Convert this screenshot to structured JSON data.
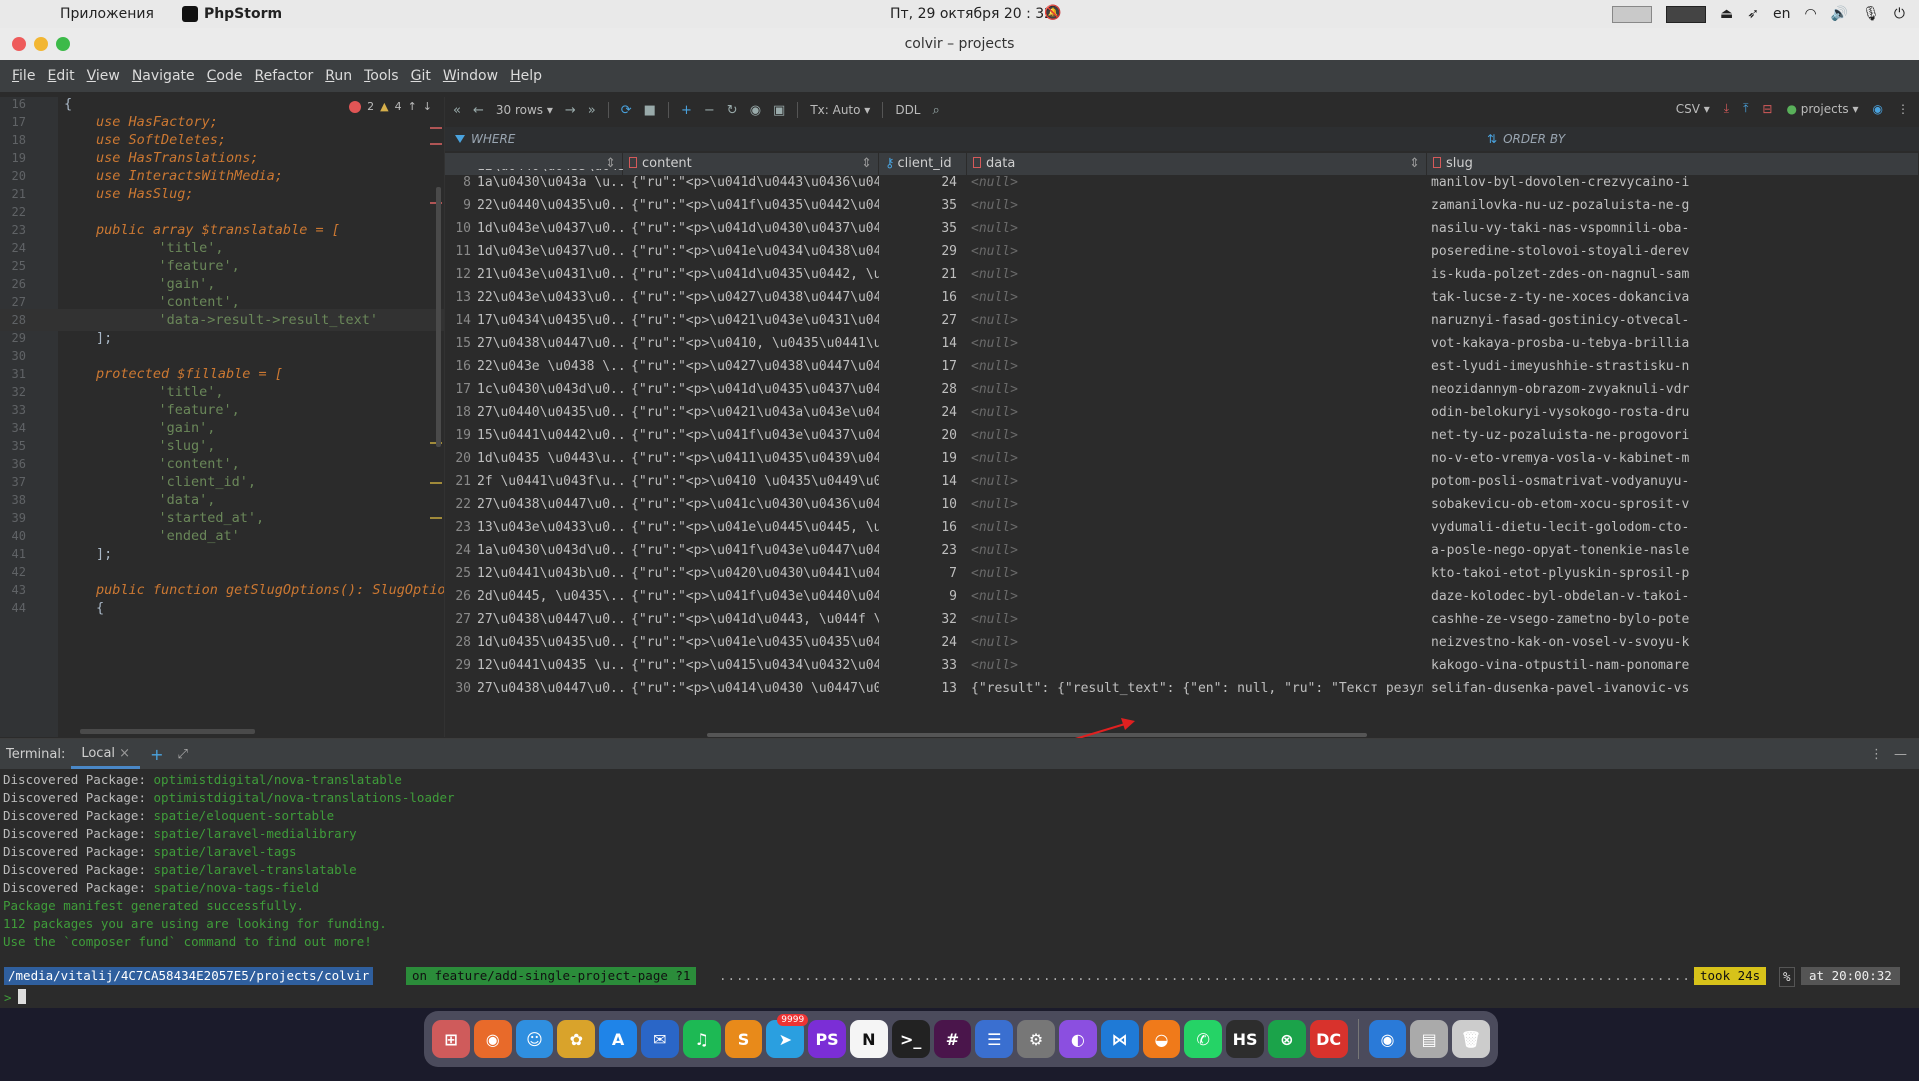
{
  "os": {
    "apple": "",
    "apps_menu": "Приложения",
    "app_name": "PhpStorm",
    "clock": "Пт, 29 октября 20 : 32",
    "lang": "en"
  },
  "window": {
    "title": "colvir – projects"
  },
  "menu": [
    "File",
    "Edit",
    "View",
    "Navigate",
    "Code",
    "Refactor",
    "Run",
    "Tools",
    "Git",
    "Window",
    "Help"
  ],
  "editor": {
    "errors": "2",
    "warnings": "4",
    "lines": [
      {
        "n": "16",
        "t": "{"
      },
      {
        "n": "17",
        "t": "use HasFactory;"
      },
      {
        "n": "18",
        "t": "use SoftDeletes;"
      },
      {
        "n": "19",
        "t": "use HasTranslations;"
      },
      {
        "n": "20",
        "t": "use InteractsWithMedia;"
      },
      {
        "n": "21",
        "t": "use HasSlug;"
      },
      {
        "n": "22",
        "t": ""
      },
      {
        "n": "23",
        "t": "public array $translatable = ["
      },
      {
        "n": "24",
        "t": "    'title',"
      },
      {
        "n": "25",
        "t": "    'feature',"
      },
      {
        "n": "26",
        "t": "    'gain',"
      },
      {
        "n": "27",
        "t": "    'content',"
      },
      {
        "n": "28",
        "t": "    'data->result->result_text'"
      },
      {
        "n": "29",
        "t": "];"
      },
      {
        "n": "30",
        "t": ""
      },
      {
        "n": "31",
        "t": "protected $fillable = ["
      },
      {
        "n": "32",
        "t": "    'title',"
      },
      {
        "n": "33",
        "t": "    'feature',"
      },
      {
        "n": "34",
        "t": "    'gain',"
      },
      {
        "n": "35",
        "t": "    'slug',"
      },
      {
        "n": "36",
        "t": "    'content',"
      },
      {
        "n": "37",
        "t": "    'client_id',"
      },
      {
        "n": "38",
        "t": "    'data',"
      },
      {
        "n": "39",
        "t": "    'started_at',"
      },
      {
        "n": "40",
        "t": "    'ended_at'"
      },
      {
        "n": "41",
        "t": "];"
      },
      {
        "n": "42",
        "t": ""
      },
      {
        "n": "43",
        "t": "public function getSlugOptions(): SlugOptior"
      },
      {
        "n": "44",
        "t": "{"
      }
    ]
  },
  "grid": {
    "rows_label": "30 rows",
    "tx_label": "Tx: Auto",
    "ddl_label": "DDL",
    "csv_label": "CSV",
    "schema_label": "projects",
    "where_label": "WHERE",
    "orderby_label": "ORDER BY",
    "columns": [
      "content",
      "client_id",
      "data",
      "slug"
    ],
    "top_partial": "12\\u0440\\u0435\\u0435\\u0",
    "null_text": "<null>",
    "rows": [
      {
        "n": "8",
        "title": "1a\\u0430\\u043a \\u...",
        "content": "{\"ru\":\"<p>\\u041d\\u0443\\u0436\\u043d\\u...",
        "client": "24",
        "data": "<null>",
        "slug": "manilov-byl-dovolen-crezvycaino-i"
      },
      {
        "n": "9",
        "title": "22\\u0440\\u0435\\u0...",
        "content": "{\"ru\":\"<p>\\u041f\\u0435\\u0442\\u0440\\u...",
        "client": "35",
        "data": "<null>",
        "slug": "zamanilovka-nu-uz-pozaluista-ne-g"
      },
      {
        "n": "10",
        "title": "1d\\u043e\\u0437\\u0...",
        "content": "{\"ru\":\"<p>\\u041d\\u0430\\u0437\\u0434\\u...",
        "client": "35",
        "data": "<null>",
        "slug": "nasilu-vy-taki-nas-vspomnili-oba-"
      },
      {
        "n": "11",
        "title": "1d\\u043e\\u0437\\u0...",
        "content": "{\"ru\":\"<p>\\u041e\\u0434\\u0438\\u043d \\u...",
        "client": "29",
        "data": "<null>",
        "slug": "poseredine-stolovoi-stoyali-derev"
      },
      {
        "n": "12",
        "title": "21\\u043e\\u0431\\u0...",
        "content": "{\"ru\":\"<p>\\u041d\\u0435\\u0442, \\u043d...",
        "client": "21",
        "data": "<null>",
        "slug": "is-kuda-polzet-zdes-on-nagnul-sam"
      },
      {
        "n": "13",
        "title": "22\\u043e\\u0433\\u0...",
        "content": "{\"ru\":\"<p>\\u0427\\u0438\\u0447\\u0438\\u...",
        "client": "16",
        "data": "<null>",
        "slug": "tak-lucse-z-ty-ne-xoces-dokanciva"
      },
      {
        "n": "14",
        "title": "17\\u0434\\u0435\\u0...",
        "content": "{\"ru\":\"<p>\\u0421\\u043e\\u0431\\u0430\\u...",
        "client": "27",
        "data": "<null>",
        "slug": "naruznyi-fasad-gostinicy-otvecal-"
      },
      {
        "n": "15",
        "title": "27\\u0438\\u0447\\u0...",
        "content": "{\"ru\":\"<p>\\u0410, \\u0435\\u0441\\u043b...",
        "client": "14",
        "data": "<null>",
        "slug": "vot-kakaya-prosba-u-tebya-brillia"
      },
      {
        "n": "16",
        "title": "22\\u043e \\u0438 \\...",
        "content": "{\"ru\":\"<p>\\u0427\\u0438\\u0447\\u0438\\u...",
        "client": "17",
        "data": "<null>",
        "slug": "est-lyudi-imeyushhie-strastisku-n"
      },
      {
        "n": "17",
        "title": "1c\\u0430\\u043d\\u0...",
        "content": "{\"ru\":\"<p>\\u041d\\u0435\\u0437\\u0434\\u...",
        "client": "28",
        "data": "<null>",
        "slug": "neozidannym-obrazom-zvyaknuli-vdr"
      },
      {
        "n": "18",
        "title": "27\\u0440\\u0435\\u0...",
        "content": "{\"ru\":\"<p>\\u0421\\u043a\\u043e\\u043b\\u...",
        "client": "24",
        "data": "<null>",
        "slug": "odin-belokuryi-vysokogo-rosta-dru"
      },
      {
        "n": "19",
        "title": "15\\u0441\\u0442\\u0...",
        "content": "{\"ru\":\"<p>\\u041f\\u043e\\u0437\\u0432\\u...",
        "client": "20",
        "data": "<null>",
        "slug": "net-ty-uz-pozaluista-ne-progovori"
      },
      {
        "n": "20",
        "title": "1d\\u0435 \\u0443\\u...",
        "content": "{\"ru\":\"<p>\\u0411\\u0435\\u0439\\u0442\\u...",
        "client": "19",
        "data": "<null>",
        "slug": "no-v-eto-vremya-vosla-v-kabinet-m"
      },
      {
        "n": "21",
        "title": "2f \\u0441\\u043f\\u...",
        "content": "{\"ru\":\"<p>\\u0410 \\u0435\\u0449\\u0435 ...",
        "client": "14",
        "data": "<null>",
        "slug": "potom-posli-osmatrivat-vodyanuyu-"
      },
      {
        "n": "22",
        "title": "27\\u0438\\u0447\\u0...",
        "content": "{\"ru\":\"<p>\\u041c\\u0430\\u0436\\u0435\\u...",
        "client": "10",
        "data": "<null>",
        "slug": "sobakevicu-ob-etom-xocu-sprosit-v"
      },
      {
        "n": "23",
        "title": "13\\u043e\\u0433\\u0...",
        "content": "{\"ru\":\"<p>\\u041e\\u0445\\u0445, \\u043d\\u0435...",
        "client": "16",
        "data": "<null>",
        "slug": "vydumali-dietu-lecit-golodom-cto-"
      },
      {
        "n": "24",
        "title": "1a\\u0430\\u043d\\u0...",
        "content": "{\"ru\":\"<p>\\u041f\\u043e\\u0447\\u0442\\u...",
        "client": "23",
        "data": "<null>",
        "slug": "a-posle-nego-opyat-tonenkie-nasle"
      },
      {
        "n": "25",
        "title": "12\\u0441\\u043b\\u0...",
        "content": "{\"ru\":\"<p>\\u0420\\u0430\\u0441\\u0441\\u...",
        "client": "7",
        "data": "<null>",
        "slug": "kto-takoi-etot-plyuskin-sprosil-p"
      },
      {
        "n": "26",
        "title": "2d\\u0445, \\u0435\\...",
        "content": "{\"ru\":\"<p>\\u041f\\u043e\\u0440\\u043e\\u...",
        "client": "9",
        "data": "<null>",
        "slug": "daze-kolodec-byl-obdelan-v-takoi-"
      },
      {
        "n": "27",
        "title": "27\\u0438\\u0447\\u0...",
        "content": "{\"ru\":\"<p>\\u041d\\u0443, \\u044f \\u043...",
        "client": "32",
        "data": "<null>",
        "slug": "cashhe-ze-vsego-zametno-bylo-pote"
      },
      {
        "n": "28",
        "title": "1d\\u0435\\u0435\\u0...",
        "content": "{\"ru\":\"<p>\\u041e\\u0435\\u0435\\u0440\\u...",
        "client": "24",
        "data": "<null>",
        "slug": "neizvestno-kak-on-vosel-v-svoyu-k"
      },
      {
        "n": "29",
        "title": "12\\u0441\\u0435 \\u...",
        "content": "{\"ru\":\"<p>\\u0415\\u0434\\u0432\\u0430 \\u...",
        "client": "33",
        "data": "<null>",
        "slug": "kakogo-vina-otpustil-nam-ponomare"
      },
      {
        "n": "30",
        "title": "27\\u0438\\u0447\\u0...",
        "content": "{\"ru\":\"<p>\\u0414\\u0430 \\u0447\\u0442\\u...",
        "client": "13",
        "data": "{\"result\": {\"result_text\": {\"en\": null, \"ru\": \"Текст результата  Текст...",
        "slug": "selifan-dusenka-pavel-ivanovic-vs"
      }
    ]
  },
  "terminal": {
    "tab_title": "Terminal:",
    "tab_local": "Local",
    "lines": [
      {
        "label": "Discovered Package: ",
        "pkg": "optimistdigital/nova-translatable"
      },
      {
        "label": "Discovered Package: ",
        "pkg": "optimistdigital/nova-translations-loader"
      },
      {
        "label": "Discovered Package: ",
        "pkg": "spatie/eloquent-sortable"
      },
      {
        "label": "Discovered Package: ",
        "pkg": "spatie/laravel-medialibrary"
      },
      {
        "label": "Discovered Package: ",
        "pkg": "spatie/laravel-tags"
      },
      {
        "label": "Discovered Package: ",
        "pkg": "spatie/laravel-translatable"
      },
      {
        "label": "Discovered Package: ",
        "pkg": "spatie/nova-tags-field"
      }
    ],
    "msg1": "Package manifest generated successfully.",
    "msg2": "112 packages you are using are looking for funding.",
    "msg3": "Use the `composer fund` command to find out more!",
    "prompt_path": " /media/vitalij/4C7CA58434E2057E5/projects/colvir ",
    "prompt_branch": " on feature/add-single-project-page ?1 ",
    "prompt_took": "took 24s",
    "prompt_pct": "%",
    "prompt_time": "at 20:00:32",
    "prompt_char": ">"
  },
  "dock": {
    "apps": [
      {
        "name": "launchpad",
        "glyph": "⊞",
        "color": "#cf5b5b"
      },
      {
        "name": "firefox",
        "glyph": "◉",
        "color": "#e86a2a"
      },
      {
        "name": "finder",
        "glyph": "☺",
        "color": "#2f8fe0"
      },
      {
        "name": "photos",
        "glyph": "✿",
        "color": "#d9a32b"
      },
      {
        "name": "app-store",
        "glyph": "A",
        "color": "#1f84e8"
      },
      {
        "name": "thunderbird",
        "glyph": "✉",
        "color": "#2a66c7"
      },
      {
        "name": "spotify",
        "glyph": "♫",
        "color": "#1db954"
      },
      {
        "name": "sublime",
        "glyph": "S",
        "color": "#e88a1a"
      },
      {
        "name": "telegram",
        "glyph": "➤",
        "color": "#2a9fe0",
        "badge": "9999"
      },
      {
        "name": "phpstorm",
        "glyph": "PS",
        "color": "#7b2ed6"
      },
      {
        "name": "notion",
        "glyph": "N",
        "color": "#f5f5f5"
      },
      {
        "name": "terminal",
        "glyph": ">_",
        "color": "#222222"
      },
      {
        "name": "slack",
        "glyph": "#",
        "color": "#4a154b"
      },
      {
        "name": "settings-switch",
        "glyph": "☰",
        "color": "#3a6fd0"
      },
      {
        "name": "system-preferences",
        "glyph": "⚙",
        "color": "#777777"
      },
      {
        "name": "podcasts",
        "glyph": "◐",
        "color": "#8b4fe0"
      },
      {
        "name": "vscode",
        "glyph": "⋈",
        "color": "#1f7ad6"
      },
      {
        "name": "sublime-merge",
        "glyph": "◒",
        "color": "#f07a1a"
      },
      {
        "name": "whatsapp",
        "glyph": "✆",
        "color": "#25d366"
      },
      {
        "name": "hs",
        "glyph": "HS",
        "color": "#2d2d2d"
      },
      {
        "name": "xbox",
        "glyph": "⊗",
        "color": "#1ba34a"
      },
      {
        "name": "dbeaver",
        "glyph": "DC",
        "color": "#d8322c"
      },
      {
        "name": "downloads",
        "glyph": "◉",
        "color": "#2a7ad8"
      },
      {
        "name": "disk",
        "glyph": "▤",
        "color": "#aaaaaa"
      },
      {
        "name": "trash",
        "glyph": "🗑",
        "color": "#cccccc"
      }
    ]
  }
}
